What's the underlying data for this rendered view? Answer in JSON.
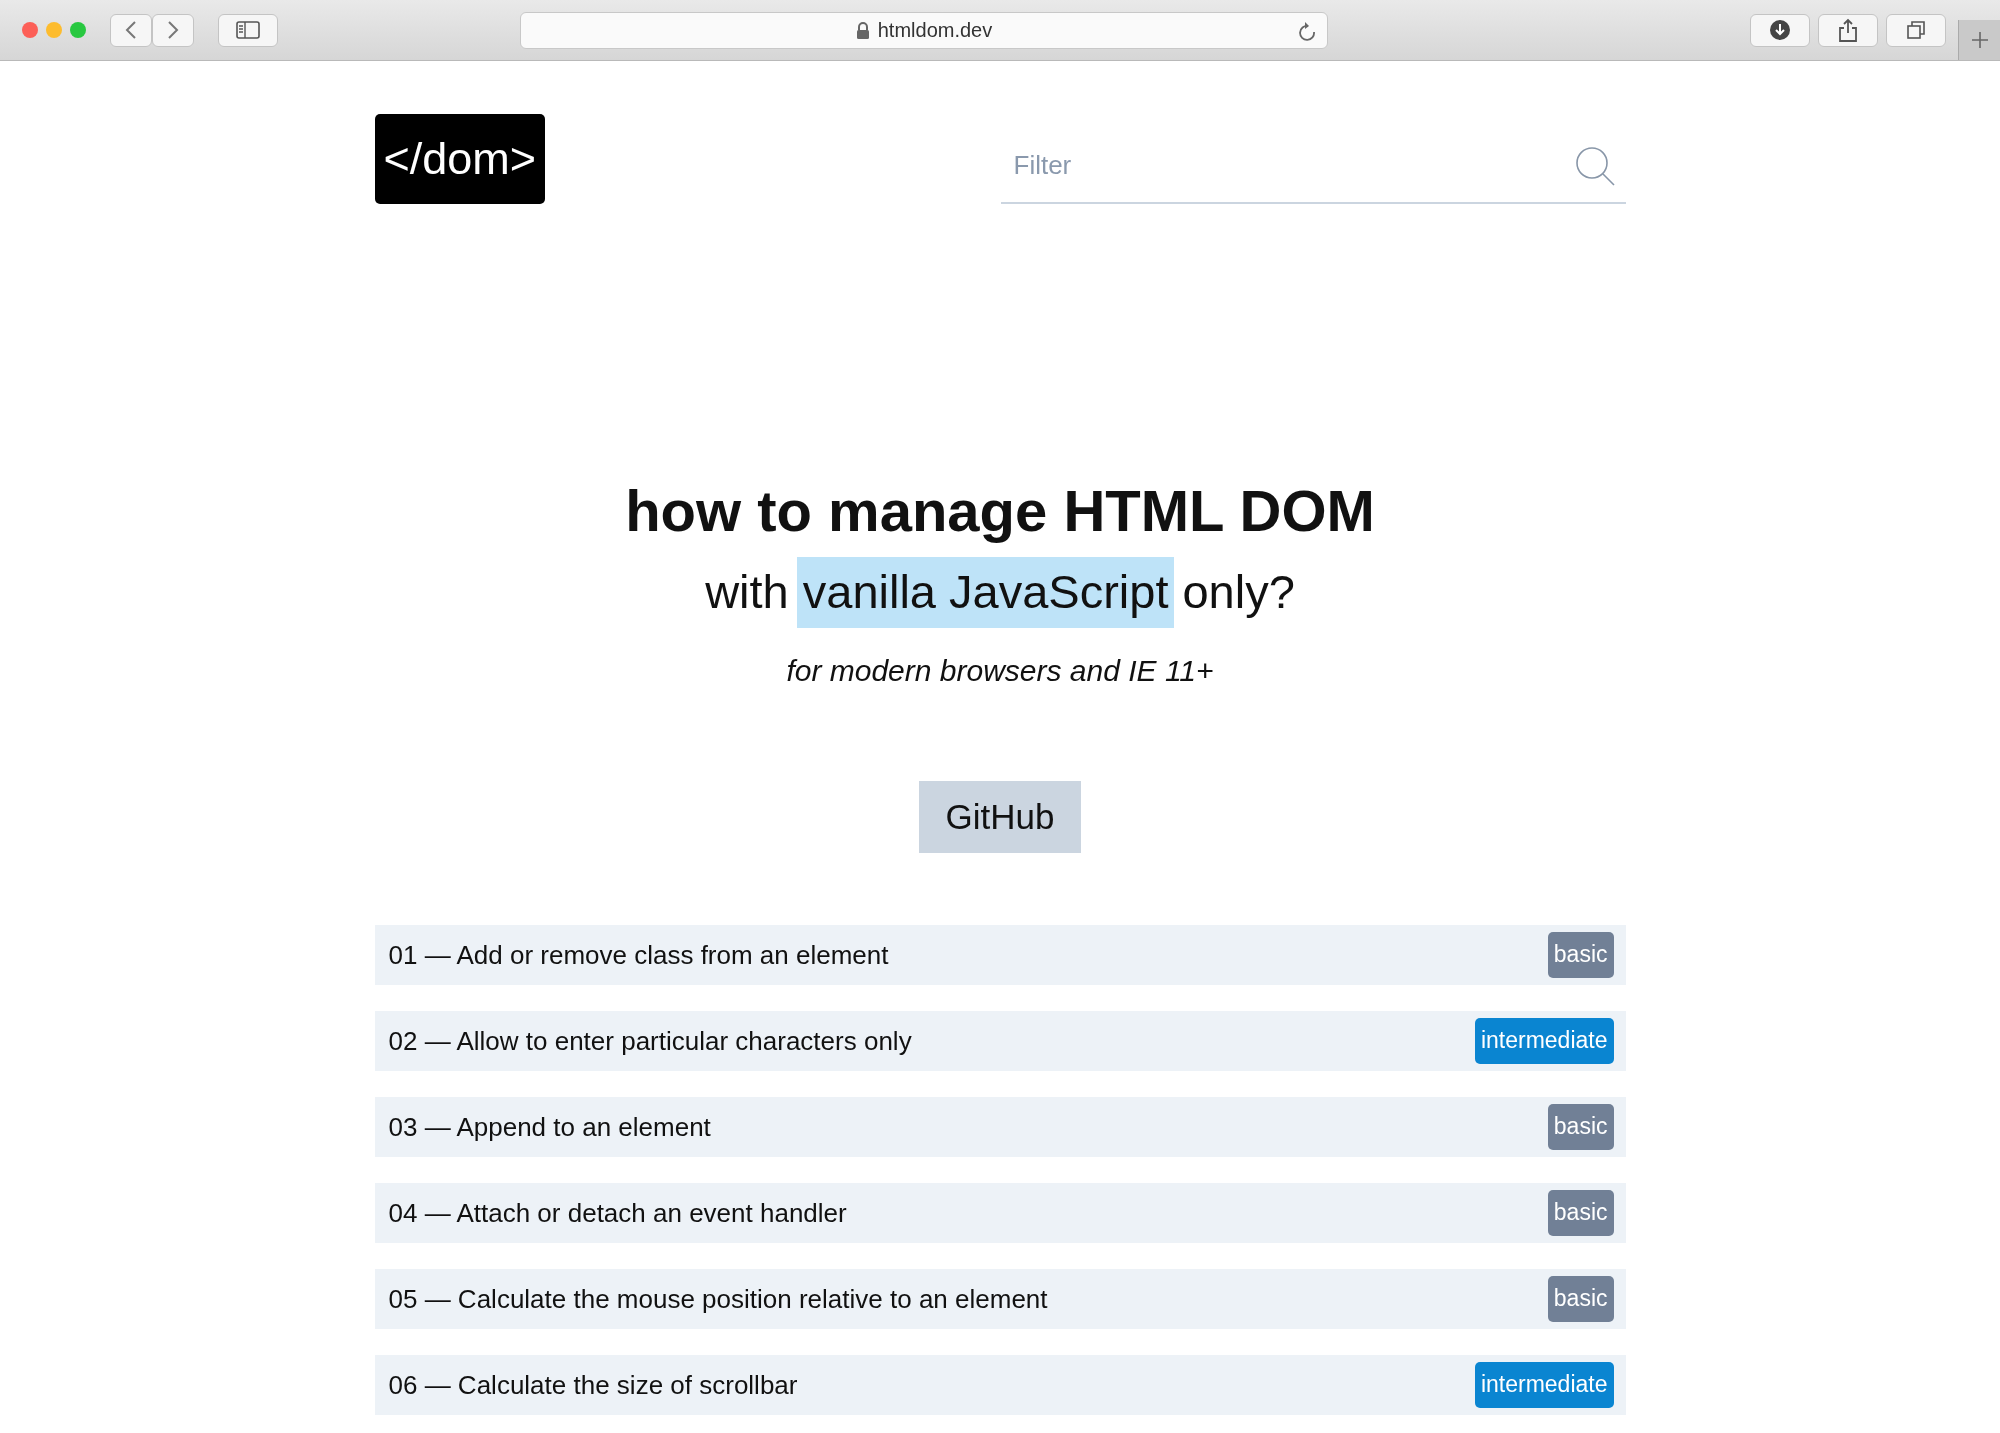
{
  "browser": {
    "url": "htmldom.dev"
  },
  "logo": {
    "text": "</dom>"
  },
  "filter": {
    "placeholder": "Filter"
  },
  "hero": {
    "title": "how to manage HTML DOM",
    "highlight": "vanilla JavaScript",
    "subtitle_before": "with",
    "subtitle_after": "only?",
    "note": "for modern browsers and IE 11+"
  },
  "github_button": "GitHub",
  "items": [
    {
      "title": "01 — Add or remove class from an element",
      "level": "basic",
      "color": "#718096"
    },
    {
      "title": "02 — Allow to enter particular characters only",
      "level": "intermediate",
      "color": "#0a85d1"
    },
    {
      "title": "03 — Append to an element",
      "level": "basic",
      "color": "#718096"
    },
    {
      "title": "04 — Attach or detach an event handler",
      "level": "basic",
      "color": "#718096"
    },
    {
      "title": "05 — Calculate the mouse position relative to an element",
      "level": "basic",
      "color": "#718096"
    },
    {
      "title": "06 — Calculate the size of scrollbar",
      "level": "intermediate",
      "color": "#0a85d1"
    }
  ]
}
